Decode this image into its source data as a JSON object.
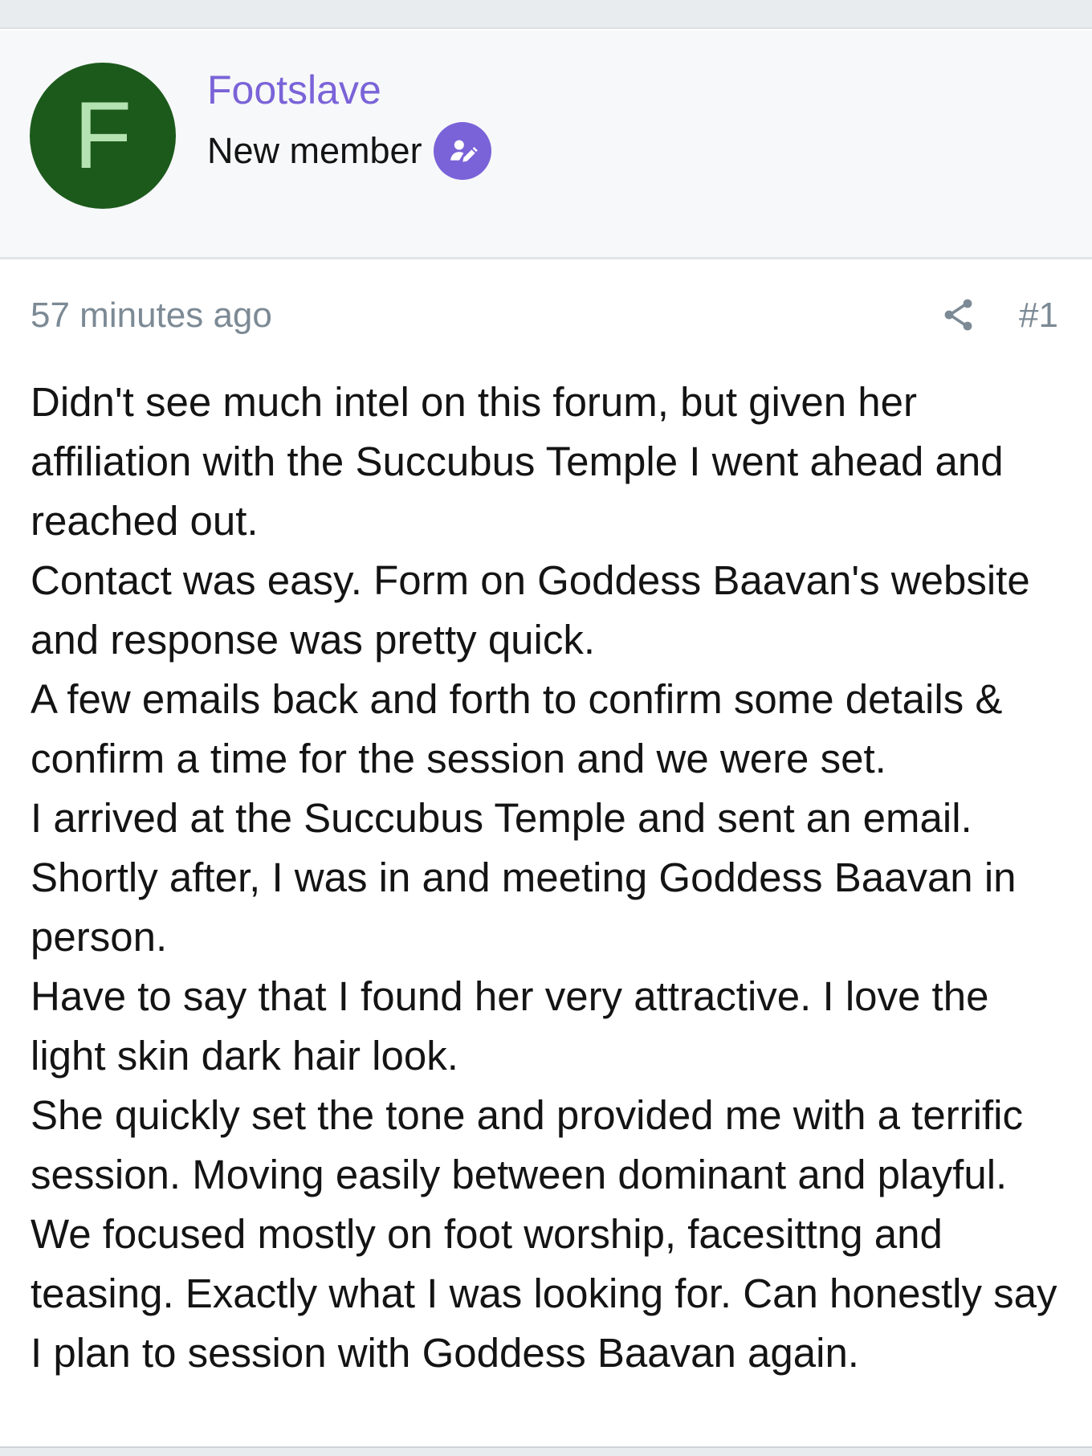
{
  "user": {
    "avatar_letter": "F",
    "name": "Footslave",
    "title": "New member",
    "badge_icon": "user-edit-icon"
  },
  "post": {
    "timestamp": "57 minutes ago",
    "share_icon": "share-icon",
    "number": "#1",
    "paragraphs": [
      "Didn't see much intel on this forum, but given her affiliation with the Succubus Temple I went ahead and reached out.",
      "Contact was easy. Form on Goddess Baavan's website and response was pretty quick.",
      "A few emails back and forth to confirm some details & confirm a time for the session and we were set.",
      "I arrived at the Succubus Temple and sent an email. Shortly after, I was in and meeting Goddess Baavan in person.",
      "Have to say that I found her very attractive. I love the light skin dark hair look.",
      "She quickly set the tone and provided me with a terrific session. Moving easily between dominant and playful. We focused mostly on foot worship, facesittng and teasing. Exactly what I was looking for. Can honestly say I plan to session with Goddess Baavan again."
    ]
  },
  "colors": {
    "accent": "#7a63d8",
    "avatar_bg": "#1c5a1c",
    "avatar_text": "#b4e2b0",
    "meta_text": "#7c8a95"
  }
}
